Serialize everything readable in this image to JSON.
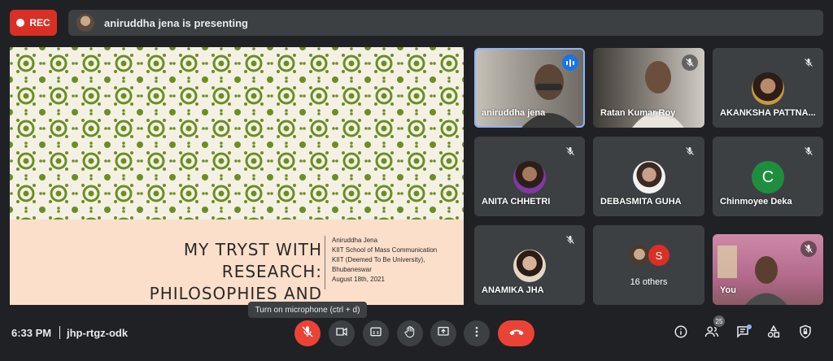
{
  "top_bar": {
    "rec_label": "REC",
    "presenting_text": "aniruddha jena is presenting"
  },
  "slide": {
    "title_line1": "MY TRYST WITH RESEARCH:",
    "title_line2": "PHILOSOPHIES AND INTERESTS",
    "author": "Aniruddha Jena",
    "school": "KIIT School of Mass Communication",
    "university": "KIIT (Deemed To Be University),",
    "city": "Bhubaneswar",
    "date": "August 18th, 2021",
    "colors": {
      "pattern": "#6b8e23",
      "bottom": "#fbdfca"
    }
  },
  "participants": [
    {
      "name": "aniruddha jena",
      "type": "video",
      "speaking": true
    },
    {
      "name": "Ratan Kumar Roy",
      "type": "video",
      "muted": true
    },
    {
      "name": "AKANKSHA PATTNA...",
      "type": "avatar",
      "muted": true
    },
    {
      "name": "ANITA CHHETRI",
      "type": "avatar",
      "muted": true
    },
    {
      "name": "DEBASMITA GUHA",
      "type": "avatar",
      "muted": true
    },
    {
      "name": "Chinmoyee Deka",
      "type": "letter",
      "letter": "C",
      "muted": true
    },
    {
      "name": "ANAMIKA JHA",
      "type": "avatar",
      "muted": true
    },
    {
      "name": "16 others",
      "type": "others",
      "letter": "S"
    },
    {
      "name": "You",
      "type": "video",
      "muted": true
    }
  ],
  "bottom_bar": {
    "time": "6:33 PM",
    "meeting_code": "jhp-rtgz-odk",
    "tooltip": "Turn on microphone (ctrl + d)",
    "people_count": "25"
  },
  "icons": [
    "mic-off-icon",
    "camera-icon",
    "captions-icon",
    "raise-hand-icon",
    "present-icon",
    "more-icon",
    "hang-up-icon",
    "info-icon",
    "people-icon",
    "chat-icon",
    "activities-icon",
    "host-controls-icon"
  ],
  "colors": {
    "background": "#202124",
    "tile": "#3c4043",
    "red": "#ea4335",
    "accent": "#8ab4f8"
  }
}
